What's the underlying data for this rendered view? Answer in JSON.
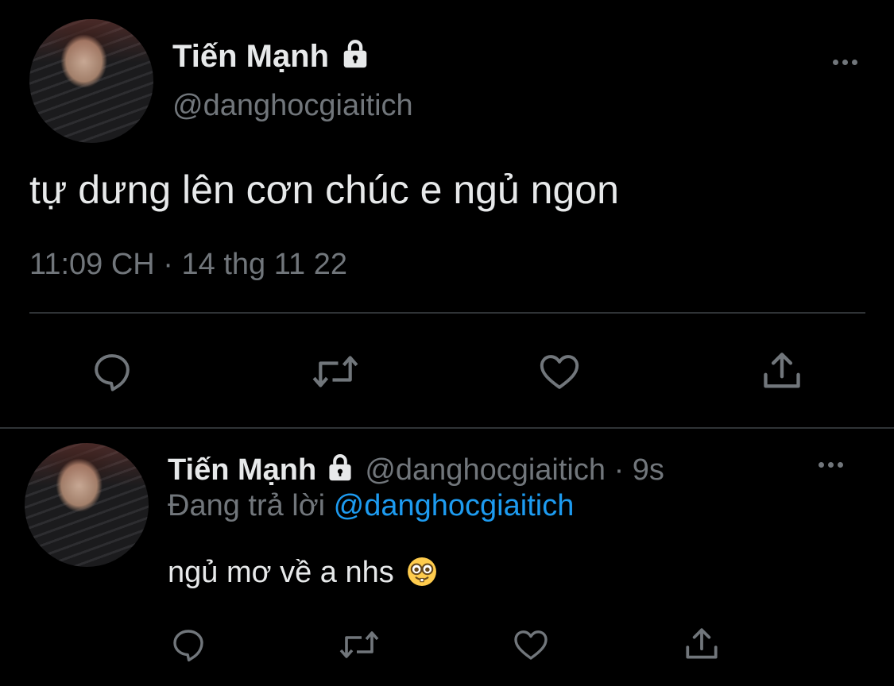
{
  "main_tweet": {
    "author_name": "Tiến Mạnh",
    "author_handle": "@danghocgiaitich",
    "text": "tự dưng lên cơn chúc e ngủ ngon",
    "time": "11:09 CH",
    "separator": "·",
    "date": "14 thg 11 22"
  },
  "reply_tweet": {
    "author_name": "Tiến Mạnh",
    "author_handle": "@danghocgiaitich",
    "separator": "·",
    "age": "9s",
    "replying_prefix": "Đang trả lời",
    "replying_to": "@danghocgiaitich",
    "text": "ngủ mơ về a nhs",
    "emoji": "🤓"
  },
  "icons": {
    "verified_lock": "lock-icon",
    "more": "more-icon",
    "reply": "reply-icon",
    "retweet": "retweet-icon",
    "like": "heart-icon",
    "share": "share-icon"
  },
  "colors": {
    "background": "#000000",
    "text": "#e7e9ea",
    "secondary": "#71767b",
    "link": "#1d9bf0",
    "divider": "#2f3336"
  }
}
